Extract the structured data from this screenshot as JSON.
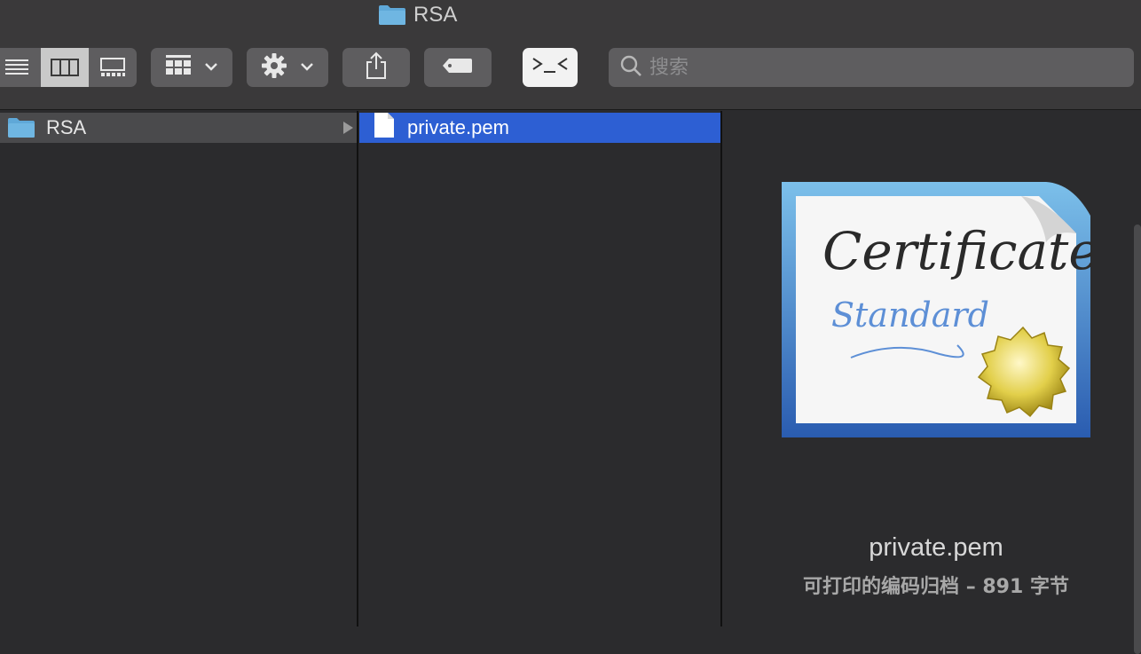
{
  "window": {
    "title": "RSA"
  },
  "toolbar": {
    "view_list": "list-view-icon",
    "view_columns": "column-view-icon",
    "view_gallery": "gallery-view-icon",
    "group_button": "group-icon",
    "action_button": "gear-icon",
    "share_button": "share-icon",
    "tag_button": "tag-icon",
    "terminal_button": "terminal-icon"
  },
  "search": {
    "placeholder": "搜索",
    "value": ""
  },
  "column1": {
    "items": [
      {
        "label": "RSA",
        "icon": "folder-icon"
      }
    ]
  },
  "column2": {
    "items": [
      {
        "label": "private.pem",
        "icon": "document-icon"
      }
    ]
  },
  "preview": {
    "name": "private.pem",
    "info": "可打印的编码归档 – 891 字节",
    "certificate_text_1": "Certificate",
    "certificate_text_2": "Standard"
  },
  "colors": {
    "selection": "#2d5fd3",
    "folder": "#5fa8d8",
    "toolbar": "#3a393a"
  }
}
